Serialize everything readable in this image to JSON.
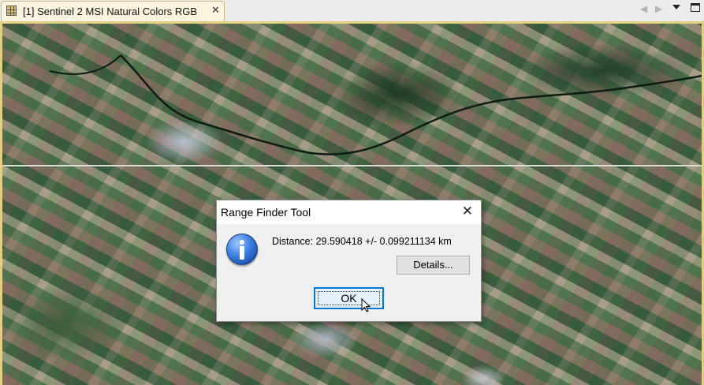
{
  "tab": {
    "title": "[1] Sentinel 2 MSI Natural Colors RGB",
    "close": "✕",
    "icon": "raster-grid-icon"
  },
  "toolbar": {
    "prev": "◀",
    "next": "▶",
    "menu_icon": "dropdown-caret-icon",
    "maximize_icon": "maximize-icon"
  },
  "dialog": {
    "title": "Range Finder Tool",
    "close": "✕",
    "icon": "info-icon",
    "message": "Distance: 29.590418 +/- 0.099211134 km",
    "details_button": "Details...",
    "ok_button": "OK"
  },
  "colors": {
    "tab_border": "#c9b47a",
    "view_border": "#e2cf83",
    "focus_blue": "#0078d7"
  }
}
